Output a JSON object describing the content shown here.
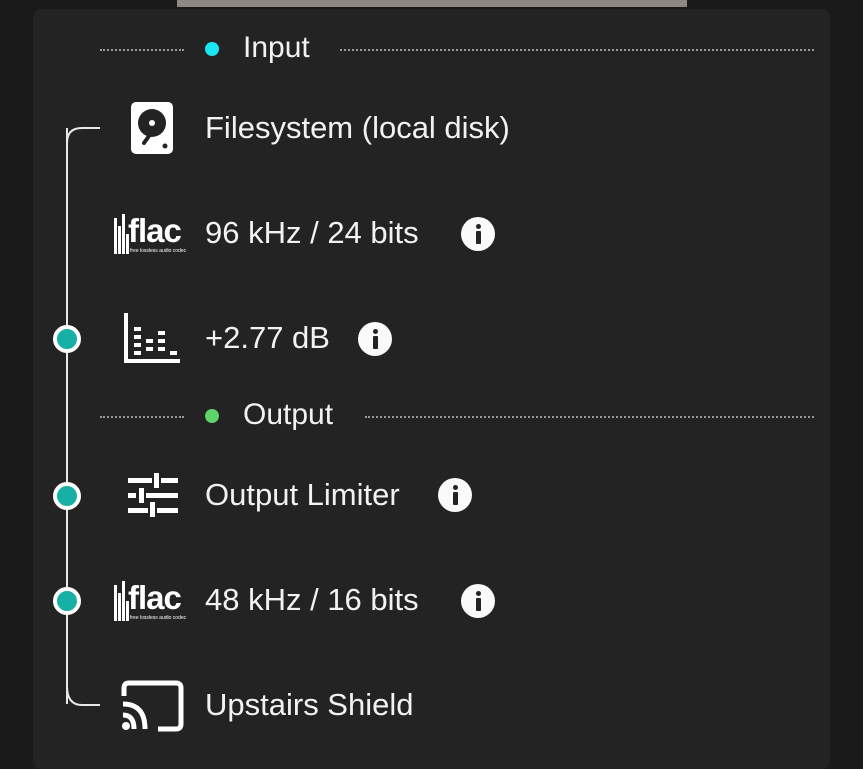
{
  "accent": {
    "teal": "#16b0a4",
    "input_dot": "#19e6f0",
    "output_dot": "#5fd36a"
  },
  "input": {
    "label": "Input",
    "source": {
      "icon": "hard-disk-icon",
      "label": "Filesystem (local disk)"
    },
    "format": {
      "icon": "flac-logo",
      "logo_text": "flac",
      "logo_tagline": "free lossless audio codec",
      "label": "96 kHz / 24 bits"
    },
    "gain": {
      "icon": "level-meter-icon",
      "label": "+2.77 dB"
    }
  },
  "output": {
    "label": "Output",
    "limiter": {
      "icon": "sliders-icon",
      "label": "Output Limiter"
    },
    "format": {
      "icon": "flac-logo",
      "logo_text": "flac",
      "logo_tagline": "free lossless audio codec",
      "label": "48 kHz / 16 bits"
    },
    "device": {
      "icon": "cast-icon",
      "label": "Upstairs Shield"
    }
  }
}
